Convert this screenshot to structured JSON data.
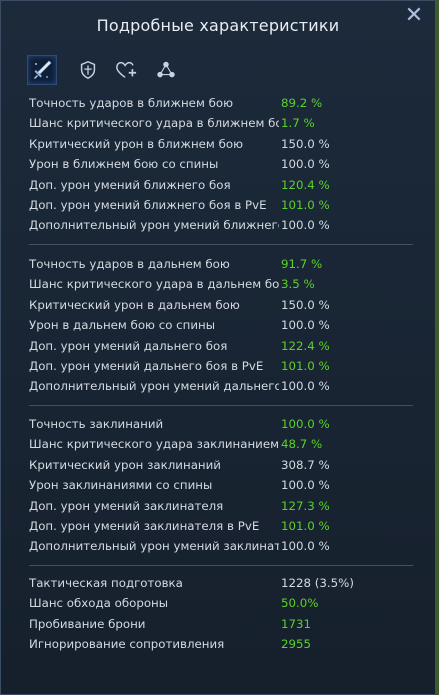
{
  "header": {
    "title": "Подробные характеристики",
    "close_symbol": "✕"
  },
  "tabs": [
    {
      "icon": "sword-icon",
      "active": true
    },
    {
      "icon": "shield-icon",
      "active": false
    },
    {
      "icon": "heart-plus-icon",
      "active": false
    },
    {
      "icon": "network-icon",
      "active": false
    }
  ],
  "colors": {
    "accent_green": "#5bd12b",
    "text": "#d4dae2",
    "panel_bg": "#1c2a3b"
  },
  "sections": [
    {
      "rows": [
        {
          "label": "Точность ударов в ближнем бою",
          "value": "89.2 %",
          "green": true
        },
        {
          "label": "Шанс критического удара в ближнем бою",
          "value": "1.7 %",
          "green": true
        },
        {
          "label": "Критический урон в ближнем бою",
          "value": "150.0 %",
          "green": false
        },
        {
          "label": "Урон в ближнем бою со спины",
          "value": "100.0 %",
          "green": false
        },
        {
          "label": "Доп. урон умений ближнего боя",
          "value": "120.4 %",
          "green": true
        },
        {
          "label": "Доп. урон умений ближнего боя в PvE",
          "value": "101.0 %",
          "green": true
        },
        {
          "label": "Дополнительный урон умений ближнего..",
          "value": "100.0 %",
          "green": false
        }
      ]
    },
    {
      "rows": [
        {
          "label": "Точность ударов в дальнем бою",
          "value": "91.7 %",
          "green": true
        },
        {
          "label": "Шанс критического удара в дальнем бою",
          "value": "3.5 %",
          "green": true
        },
        {
          "label": "Критический урон в дальнем бою",
          "value": "150.0 %",
          "green": false
        },
        {
          "label": "Урон в дальнем бою со спины",
          "value": "100.0 %",
          "green": false
        },
        {
          "label": "Доп. урон умений дальнего боя",
          "value": "122.4 %",
          "green": true
        },
        {
          "label": "Доп. урон умений дальнего боя в PvE",
          "value": "101.0 %",
          "green": true
        },
        {
          "label": "Дополнительный урон умений дальнего ..",
          "value": "100.0 %",
          "green": false
        }
      ]
    },
    {
      "rows": [
        {
          "label": "Точность заклинаний",
          "value": "100.0 %",
          "green": true
        },
        {
          "label": "Шанс критического удара заклинанием",
          "value": "48.7 %",
          "green": true
        },
        {
          "label": "Критический урон заклинаний",
          "value": "308.7 %",
          "green": false
        },
        {
          "label": "Урон заклинаниями со спины",
          "value": "100.0 %",
          "green": false
        },
        {
          "label": "Доп. урон умений заклинателя",
          "value": "127.3 %",
          "green": true
        },
        {
          "label": "Доп. урон умений заклинателя в PvE",
          "value": "101.0 %",
          "green": true
        },
        {
          "label": "Дополнительный урон умений заклинате..",
          "value": "100.0 %",
          "green": false
        }
      ]
    },
    {
      "rows": [
        {
          "label": "Тактическая подготовка",
          "value": "1228 (3.5%)",
          "green": false
        },
        {
          "label": "Шанс обхода обороны",
          "value": "50.0%",
          "green": true
        },
        {
          "label": "Пробивание брони",
          "value": "1731",
          "green": true
        },
        {
          "label": "Игнорирование сопротивления",
          "value": "2955",
          "green": true
        }
      ]
    }
  ]
}
